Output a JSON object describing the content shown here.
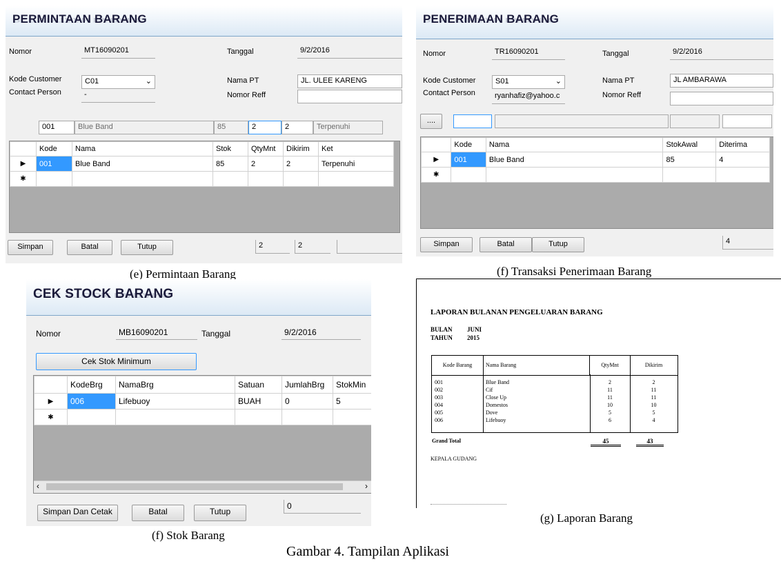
{
  "e": {
    "title": "PERMINTAAN BARANG",
    "nomor_label": "Nomor",
    "nomor": "MT16090201",
    "tanggal_label": "Tanggal",
    "tanggal": "9/2/2016",
    "kode_customer_label": "Kode Customer",
    "kode_customer": "C01",
    "nama_pt_label": "Nama PT",
    "nama_pt": "JL. ULEE KARENG",
    "contact_label": "Contact Person",
    "contact": "-",
    "reff_label": "Nomor Reff",
    "reff": "",
    "entry": {
      "kode": "001",
      "nama": "Blue Band",
      "stok": "85",
      "qty": "2",
      "dikirim": "2",
      "ket": "Terpenuhi"
    },
    "columns": [
      "Kode",
      "Nama",
      "Stok",
      "QtyMnt",
      "Dikirim",
      "Ket"
    ],
    "rows": [
      [
        "001",
        "Blue Band",
        "85",
        "2",
        "2",
        "Terpenuhi"
      ]
    ],
    "simpan": "Simpan",
    "batal": "Batal",
    "tutup": "Tutup",
    "total_qty": "2",
    "total_dikirim": "2",
    "caption": "(e) Permintaan Barang"
  },
  "f1": {
    "title": "PENERIMAAN BARANG",
    "nomor_label": "Nomor",
    "nomor": "TR16090201",
    "tanggal_label": "Tanggal",
    "tanggal": "9/2/2016",
    "kode_customer_label": "Kode Customer",
    "kode_customer": "S01",
    "nama_pt_label": "Nama PT",
    "nama_pt": "JL AMBARAWA",
    "contact_label": "Contact Person",
    "contact": "ryanhafiz@yahoo.c",
    "reff_label": "Nomor Reff",
    "reff": "",
    "browse": "....",
    "columns": [
      "Kode",
      "Nama",
      "StokAwal",
      "Diterima"
    ],
    "rows": [
      [
        "001",
        "Blue Band",
        "85",
        "4"
      ]
    ],
    "simpan": "Simpan",
    "batal": "Batal",
    "tutup": "Tutup",
    "total": "4",
    "caption": "(f) Transaksi Penerimaan Barang"
  },
  "f2": {
    "title": "CEK STOCK BARANG",
    "nomor_label": "Nomor",
    "nomor": "MB16090201",
    "tanggal_label": "Tanggal",
    "tanggal": "9/2/2016",
    "cek": "Cek Stok Minimum",
    "columns": [
      "KodeBrg",
      "NamaBrg",
      "Satuan",
      "JumlahBrg",
      "StokMin"
    ],
    "rows": [
      [
        "006",
        "Lifebuoy",
        "BUAH",
        "0",
        "5"
      ]
    ],
    "simpan": "Simpan Dan Cetak",
    "batal": "Batal",
    "tutup": "Tutup",
    "total": "0",
    "caption": "(f) Stok Barang"
  },
  "g": {
    "title": "LAPORAN BULANAN PENGELUARAN BARANG",
    "bulan_label": "BULAN",
    "bulan": "JUNI",
    "tahun_label": "TAHUN",
    "tahun": "2015",
    "columns": [
      "Kode Barang",
      "Nama Barang",
      "QtyMnt",
      "Dikirim"
    ],
    "rows": [
      [
        "001",
        "Blue Band",
        "2",
        "2"
      ],
      [
        "002",
        "Cif",
        "11",
        "11"
      ],
      [
        "003",
        "Close Up",
        "11",
        "11"
      ],
      [
        "004",
        "Domestos",
        "10",
        "10"
      ],
      [
        "005",
        "Dove",
        "5",
        "5"
      ],
      [
        "006",
        "Lifebuoy",
        "6",
        "4"
      ]
    ],
    "grand_total_label": "Grand Total",
    "grand_qty": "45",
    "grand_dikirim": "43",
    "kepala": "KEPALA GUDANG",
    "caption": "(g) Laporan Barang"
  },
  "figure_caption": "Gambar 4. Tampilan Aplikasi"
}
